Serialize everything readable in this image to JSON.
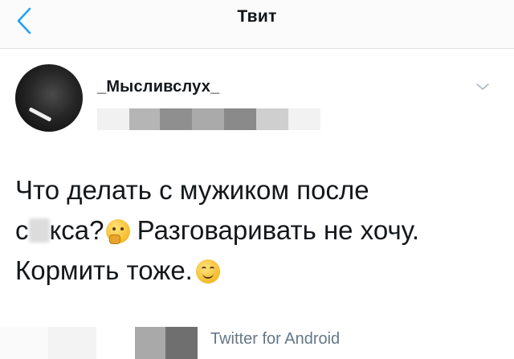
{
  "header": {
    "title": "Твит",
    "back_icon": "chevron-left-icon",
    "accent_color": "#1da1f2"
  },
  "tweet": {
    "username": "_Мысливслух_",
    "text": {
      "line1": "Что делать с мужиком после",
      "line2_start": "с",
      "line2_mid": "кса?",
      "line2_end": " Разговаривать не хочу.",
      "line3": "Кормить тоже."
    },
    "emojis": [
      "thinking-face-icon",
      "smiling-face-icon"
    ],
    "source": "Twitter for Android",
    "menu_icon": "chevron-down-icon"
  }
}
